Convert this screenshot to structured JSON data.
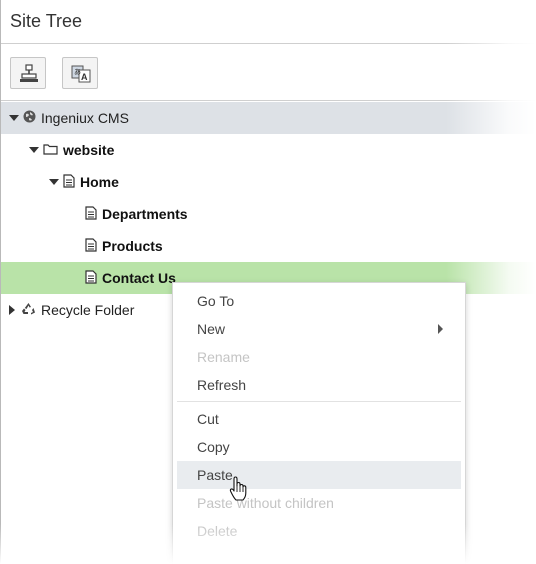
{
  "panel": {
    "title": "Site Tree"
  },
  "toolbar": {
    "buttons": [
      {
        "icon": "check-in-icon"
      },
      {
        "icon": "translate-icon"
      }
    ]
  },
  "tree": {
    "root": {
      "label": "Ingeniux CMS",
      "icon": "globe-icon",
      "expanded": true
    },
    "website": {
      "label": "website",
      "icon": "folder-icon",
      "expanded": true
    },
    "home": {
      "label": "Home",
      "icon": "page-icon",
      "expanded": true
    },
    "departments": {
      "label": "Departments",
      "icon": "page-icon"
    },
    "products": {
      "label": "Products",
      "icon": "page-icon"
    },
    "contact": {
      "label": "Contact Us",
      "icon": "page-icon",
      "selected": true
    },
    "recycle": {
      "label": "Recycle Folder",
      "icon": "recycle-icon",
      "expanded": false
    }
  },
  "context_menu": {
    "items": [
      {
        "label": "Go To",
        "enabled": true
      },
      {
        "label": "New",
        "enabled": true,
        "submenu": true
      },
      {
        "label": "Rename",
        "enabled": false
      },
      {
        "label": "Refresh",
        "enabled": true
      },
      {
        "label": "Cut",
        "enabled": true
      },
      {
        "label": "Copy",
        "enabled": true
      },
      {
        "label": "Paste",
        "enabled": true,
        "hover": true
      },
      {
        "label": "Paste without children",
        "enabled": false
      },
      {
        "label": "Delete",
        "enabled": false
      }
    ]
  },
  "colors": {
    "root_row": "#dde1e6",
    "selected_row": "#b9e3a8",
    "menu_hover": "#e9ecef"
  }
}
